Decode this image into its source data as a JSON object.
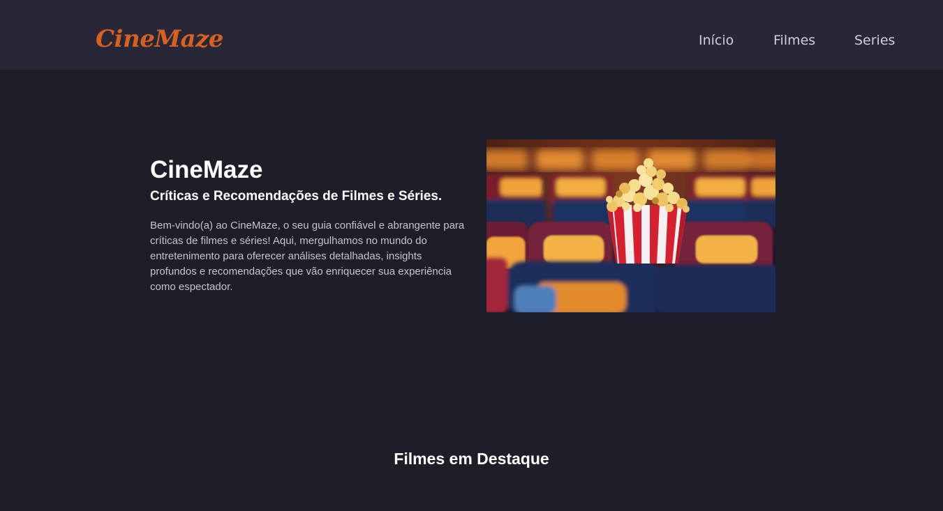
{
  "header": {
    "logo": "CineMaze",
    "nav": [
      {
        "label": "Início"
      },
      {
        "label": "Filmes"
      },
      {
        "label": "Series"
      }
    ]
  },
  "hero": {
    "title": "CineMaze",
    "subtitle": "Críticas e Recomendações de Filmes e Séries.",
    "description": "Bem-vindo(a) ao CineMaze, o seu guia confiável e abrangente para críticas de filmes e séries! Aqui, mergulhamos no mundo do entretenimento para oferecer análises detalhadas, insights profundos e recomendações que vão enriquecer sua experiência como espectador.",
    "image": "popcorn-in-cinema-seats"
  },
  "featured": {
    "title": "Filmes em Destaque"
  },
  "colors": {
    "background": "#1e1e28",
    "navbar": "#272738",
    "brand": "#d65f22"
  }
}
